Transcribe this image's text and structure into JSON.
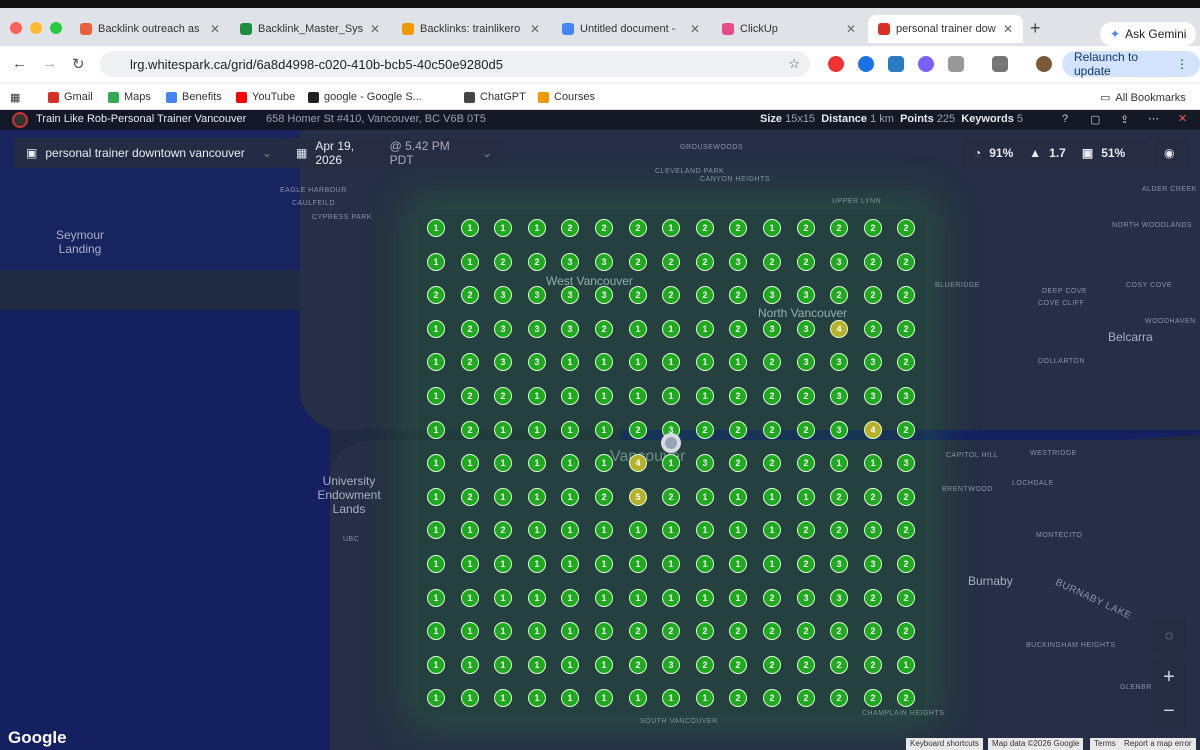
{
  "browser": {
    "tabs": [
      {
        "label": "Backlink outreach as",
        "color": "#e8613a"
      },
      {
        "label": "Backlink_Master_Sys",
        "color": "#1e8e3e"
      },
      {
        "label": "Backlinks: trainlikero",
        "color": "#f29900"
      },
      {
        "label": "Untitled document -",
        "color": "#4285f4"
      },
      {
        "label": "ClickUp",
        "color": "#e44d8a"
      },
      {
        "label": "personal trainer dow",
        "color": "#d93025"
      }
    ],
    "new_tab": "+",
    "ask_gemini": "Ask Gemini",
    "url": "lrg.whitespark.ca/grid/6a8d4998-c020-410b-bcb5-40c50e9280d5",
    "relaunch": "Relaunch to update",
    "bookmarks": [
      "Gmail",
      "Maps",
      "Benefits",
      "YouTube",
      "google - Google S...",
      "ChatGPT",
      "Courses"
    ],
    "all_bookmarks": "All Bookmarks"
  },
  "app": {
    "business_title": "Train Like Rob-Personal Trainer Vancouver",
    "business_address": "658 Homer St #410, Vancouver, BC V6B 0T5",
    "stats": {
      "size_label": "Size",
      "size": "15x15",
      "distance_label": "Distance",
      "distance": "1 km",
      "points_label": "Points",
      "points": "225",
      "keywords_label": "Keywords",
      "keywords": "5"
    },
    "keyword": "personal trainer downtown vancouver",
    "date": "Apr 19, 2026",
    "time": "@ 5.42 PM PDT",
    "metrics": {
      "visibility": "91%",
      "avg_rank": "1.7",
      "top3": "51%"
    },
    "attribution": [
      "Keyboard shortcuts",
      "Map data ©2026 Google",
      "Terms",
      "Report a map error"
    ],
    "google_logo": "Google"
  },
  "map_labels": [
    {
      "t": "GROUSEWOODS"
    },
    {
      "t": "CLEVELAND PARK"
    },
    {
      "t": "CANYON HEIGHTS"
    },
    {
      "t": "EAGLE HARBOUR"
    },
    {
      "t": "CAULFEILD"
    },
    {
      "t": "CYPRESS PARK"
    },
    {
      "t": "UPPER LYNN"
    },
    {
      "t": "ALDER CREEK"
    },
    {
      "t": "Seymour Landing"
    },
    {
      "t": "NORTH WOODLANDS"
    },
    {
      "t": "BLUERIDGE"
    },
    {
      "t": "DEEP COVE"
    },
    {
      "t": "COVE CLIFF"
    },
    {
      "t": "COSY COVE"
    },
    {
      "t": "WOODHAVEN"
    },
    {
      "t": "Belcarra"
    },
    {
      "t": "DOLLARTON"
    },
    {
      "t": "CAPITOL HILL"
    },
    {
      "t": "WESTRIDGE"
    },
    {
      "t": "University Endowment Lands"
    },
    {
      "t": "BRENTWOOD"
    },
    {
      "t": "LOCHDALE"
    },
    {
      "t": "MONTECITO"
    },
    {
      "t": "Burnaby"
    },
    {
      "t": "Burnaby Lake"
    },
    {
      "t": "BUCKINGHAM HEIGHTS"
    },
    {
      "t": "GLENBR"
    },
    {
      "t": "UBC"
    },
    {
      "t": "West Vancouver"
    },
    {
      "t": "North Vancouver"
    },
    {
      "t": "Vancouver"
    },
    {
      "t": "SOUTH VANCOUVER"
    },
    {
      "t": "CHAMPLAIN HEIGHTS"
    }
  ],
  "grid": [
    [
      1,
      1,
      1,
      1,
      2,
      2,
      2,
      1,
      2,
      2,
      1,
      2,
      2,
      2,
      2
    ],
    [
      1,
      1,
      2,
      2,
      3,
      3,
      2,
      2,
      2,
      3,
      2,
      2,
      3,
      2,
      2
    ],
    [
      2,
      2,
      3,
      3,
      3,
      3,
      2,
      2,
      2,
      2,
      3,
      3,
      2,
      2,
      2
    ],
    [
      1,
      2,
      3,
      3,
      3,
      2,
      1,
      1,
      1,
      2,
      3,
      3,
      4,
      2,
      2
    ],
    [
      1,
      2,
      3,
      3,
      1,
      1,
      1,
      1,
      1,
      1,
      2,
      3,
      3,
      3,
      2
    ],
    [
      1,
      2,
      2,
      1,
      1,
      1,
      1,
      1,
      1,
      2,
      2,
      2,
      3,
      3,
      3
    ],
    [
      1,
      2,
      1,
      1,
      1,
      1,
      2,
      3,
      2,
      2,
      2,
      2,
      3,
      4,
      2
    ],
    [
      1,
      1,
      1,
      1,
      1,
      1,
      4,
      1,
      3,
      2,
      2,
      2,
      1,
      1,
      3
    ],
    [
      1,
      2,
      1,
      1,
      1,
      2,
      5,
      2,
      1,
      1,
      1,
      1,
      2,
      2,
      2
    ],
    [
      1,
      1,
      2,
      1,
      1,
      1,
      1,
      1,
      1,
      1,
      1,
      2,
      2,
      3,
      2
    ],
    [
      1,
      1,
      1,
      1,
      1,
      1,
      1,
      1,
      1,
      1,
      1,
      2,
      3,
      3,
      2
    ],
    [
      1,
      1,
      1,
      1,
      1,
      1,
      1,
      1,
      1,
      1,
      2,
      3,
      3,
      2,
      2
    ],
    [
      1,
      1,
      1,
      1,
      1,
      1,
      2,
      2,
      2,
      2,
      2,
      2,
      2,
      2,
      2
    ],
    [
      1,
      1,
      1,
      1,
      1,
      1,
      2,
      3,
      2,
      2,
      2,
      2,
      2,
      2,
      1
    ],
    [
      1,
      1,
      1,
      1,
      1,
      1,
      1,
      1,
      1,
      2,
      2,
      2,
      2,
      2,
      2
    ]
  ]
}
